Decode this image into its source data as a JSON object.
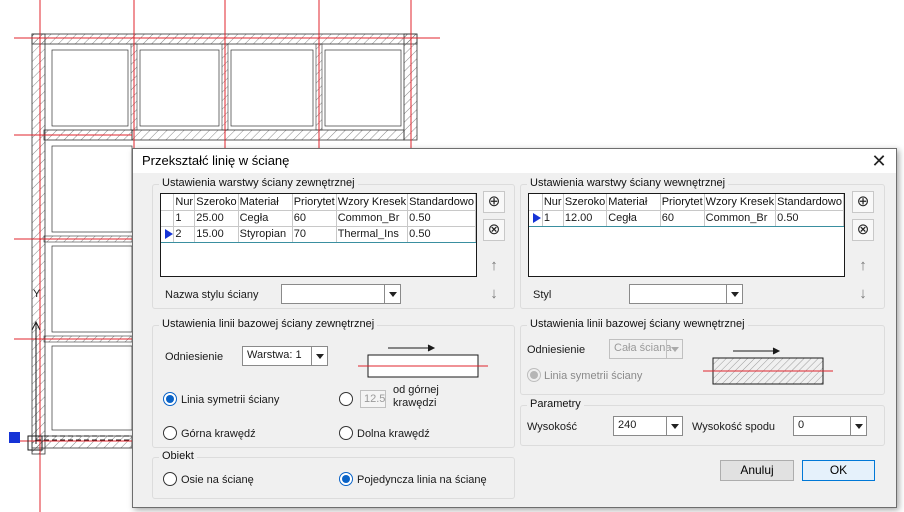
{
  "dialog": {
    "title": "Przekształć linię w ścianę",
    "close_glyph": "✕"
  },
  "outer_layers": {
    "legend": "Ustawienia warstwy ściany zewnętrznej",
    "columns": [
      "Nur",
      "Szeroko",
      "Materiał",
      "Priorytet",
      "Wzory Kresek",
      "Standardowo"
    ],
    "rows": [
      {
        "num": "1",
        "width": "25.00",
        "material": "Cegła",
        "priority": "60",
        "pattern": "Common_Br",
        "standard": "0.50",
        "selected": false
      },
      {
        "num": "2",
        "width": "15.00",
        "material": "Styropian",
        "priority": "70",
        "pattern": "Thermal_Ins",
        "standard": "0.50",
        "selected": true
      }
    ],
    "style_label": "Nazwa stylu ściany",
    "style_value": ""
  },
  "inner_layers": {
    "legend": "Ustawienia warstwy ściany wewnętrznej",
    "columns": [
      "Nur",
      "Szeroko",
      "Materiał",
      "Priorytet",
      "Wzory Kresek",
      "Standardowo"
    ],
    "rows": [
      {
        "num": "1",
        "width": "12.00",
        "material": "Cegła",
        "priority": "60",
        "pattern": "Common_Br",
        "standard": "0.50",
        "selected": true
      }
    ],
    "style_label": "Styl",
    "style_value": ""
  },
  "side_buttons": {
    "add": "⊕",
    "remove": "⊗",
    "up": "↑",
    "down": "↓"
  },
  "outer_baseline": {
    "legend": "Ustawienia linii bazowej ściany zewnętrznej",
    "reference_label": "Odniesienie",
    "reference_value": "Warstwa: 1",
    "options": {
      "symmetry": "Linia symetrii ściany",
      "offset_value": "12.5",
      "offset_label": "od górnej krawędzi",
      "top": "Górna krawędź",
      "bottom": "Dolna krawędź"
    },
    "selected": "symmetry"
  },
  "inner_baseline": {
    "legend": "Ustawienia linii bazowej ściany wewnętrznej",
    "reference_label": "Odniesienie",
    "reference_value": "Cała ściana",
    "symmetry": "Linia symetrii ściany"
  },
  "parameters": {
    "legend": "Parametry",
    "height_label": "Wysokość",
    "height_value": "240",
    "bottom_label": "Wysokość spodu",
    "bottom_value": "0"
  },
  "object": {
    "legend": "Obiekt",
    "axes": "Osie na ścianę",
    "single": "Pojedyncza linia na ścianę",
    "selected": "single"
  },
  "buttons": {
    "cancel": "Anuluj",
    "ok": "OK"
  },
  "colors": {
    "axis_red": "#e0242c",
    "selection_blue": "#1533d6",
    "accent": "#0078d7"
  },
  "cad_ucs_label": "Y"
}
